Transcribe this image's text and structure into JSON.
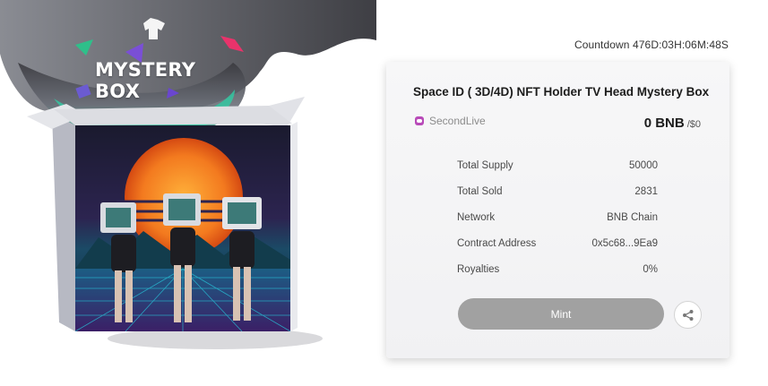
{
  "hero": {
    "title": "MYSTERY BOX"
  },
  "countdown": {
    "text": "Countdown 476D:03H:06M:48S"
  },
  "card": {
    "title": "Space ID ( 3D/4D) NFT Holder TV Head Mystery Box",
    "creator": "SecondLive",
    "price": "0 BNB",
    "price_usd": "/$0",
    "specs": [
      {
        "label": "Total Supply",
        "value": "50000"
      },
      {
        "label": "Total Sold",
        "value": "2831"
      },
      {
        "label": "Network",
        "value": "BNB Chain"
      },
      {
        "label": "Contract Address",
        "value": "0x5c68...9Ea9"
      },
      {
        "label": "Royalties",
        "value": "0%"
      }
    ],
    "mint_label": "Mint"
  },
  "icons": {
    "creator": "secondlive-logo-icon",
    "share": "share-icon"
  },
  "colors": {
    "mint_button": "#a1a1a1",
    "creator_accent": "#b84ab8",
    "sun_orange": "#f37a1f",
    "grid_cyan": "#27c0d6"
  }
}
